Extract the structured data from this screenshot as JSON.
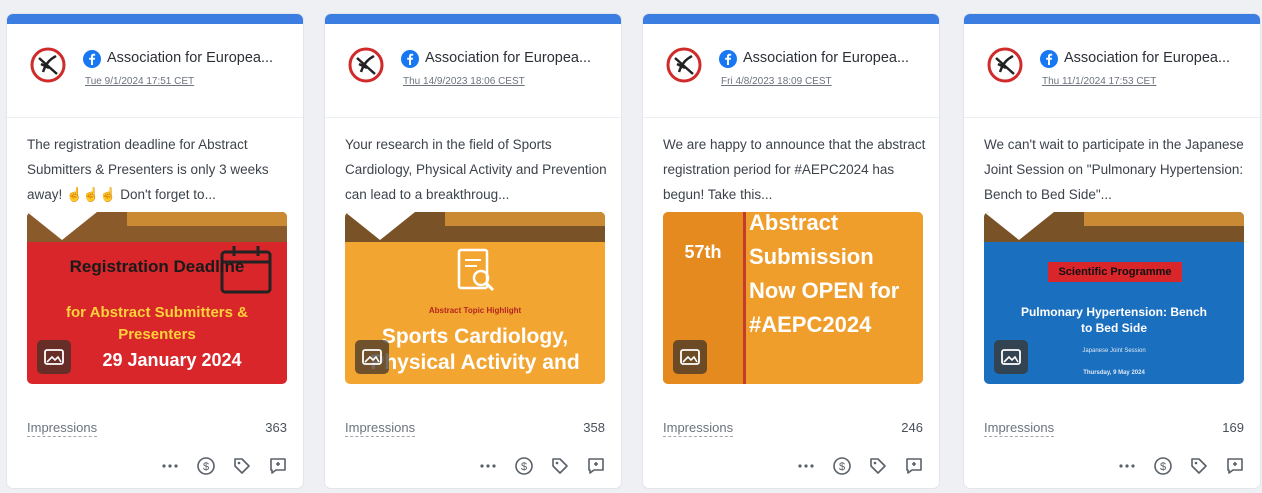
{
  "org_name": "Association for Europea...",
  "impressions_label": "Impressions",
  "icons": {
    "network": "facebook-icon",
    "more": "more-icon",
    "boost": "dollar-icon",
    "tag": "tag-icon",
    "reply": "reply-icon",
    "media": "image-icon"
  },
  "colors": {
    "topbar": "#3b7de0",
    "post1": "#d8262a",
    "post2": "#f3a532",
    "post3": "#ef9d2b",
    "post4": "#1a6fbf"
  },
  "posts": [
    {
      "date": "Tue 9/1/2024 17:51 CET",
      "text": "The registration deadline for Abstract Submitters & Presenters is only 3 weeks away! ☝☝☝ Don't forget to...",
      "impressions": "363",
      "media": {
        "title": "Registration Deadline",
        "subtitle": "for Abstract Submitters & Presenters",
        "date": "29 January 2024"
      }
    },
    {
      "date": "Thu 14/9/2023 18:06 CEST",
      "text": "Your research in the field of Sports Cardiology, Physical Activity and Prevention can lead to a breakthroug...",
      "impressions": "358",
      "media": {
        "eyebrow": "Abstract Topic Highlight",
        "title": "Sports Cardiology, Physical Activity and"
      }
    },
    {
      "date": "Fri 4/8/2023 18:09 CEST",
      "text": "We are happy to announce that the abstract registration period for #AEPC2024 has begun! Take this...",
      "impressions": "246",
      "media": {
        "number": "57th",
        "title": "Abstract Submission Now OPEN for #AEPC2024"
      }
    },
    {
      "date": "Thu 11/1/2024 17:53 CET",
      "text": "We can't wait to participate in the Japanese Joint Session on \"Pulmonary Hypertension: Bench to Bed Side\"...",
      "impressions": "169",
      "media": {
        "badge": "Scientific Programme",
        "title": "Pulmonary Hypertension: Bench to Bed Side",
        "subtitle": "Japanese Joint Session",
        "date": "Thursday, 9 May 2024"
      }
    }
  ]
}
